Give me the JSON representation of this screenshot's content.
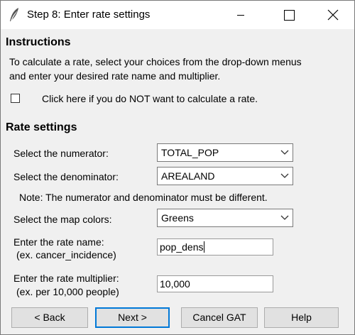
{
  "window": {
    "title": "Step 8: Enter rate settings"
  },
  "instructions": {
    "heading": "Instructions",
    "line1": "To calculate a rate, select your choices from the drop-down menus",
    "line2": "and enter your desired rate name and multiplier.",
    "checkbox_label": "Click here if you do NOT want to calculate a rate.",
    "checkbox_checked": false
  },
  "rate_settings": {
    "heading": "Rate settings",
    "numerator_label": "Select the numerator:",
    "numerator_value": "TOTAL_POP",
    "denominator_label": "Select the denominator:",
    "denominator_value": "AREALAND",
    "note": "Note: The numerator and denominator must be different.",
    "colors_label": "Select the map colors:",
    "colors_value": "Greens",
    "rate_name_label": "Enter the rate name:",
    "rate_name_example": "(ex. cancer_incidence)",
    "rate_name_value": "pop_dens",
    "multiplier_label": "Enter the rate multiplier:",
    "multiplier_example": "(ex. per 10,000 people)",
    "multiplier_value": "10,000"
  },
  "buttons": {
    "back": "< Back",
    "next": "Next >",
    "cancel": "Cancel GAT",
    "help": "Help"
  },
  "icons": {
    "app": "feather-icon",
    "dropdown": "chevron-down-icon"
  }
}
